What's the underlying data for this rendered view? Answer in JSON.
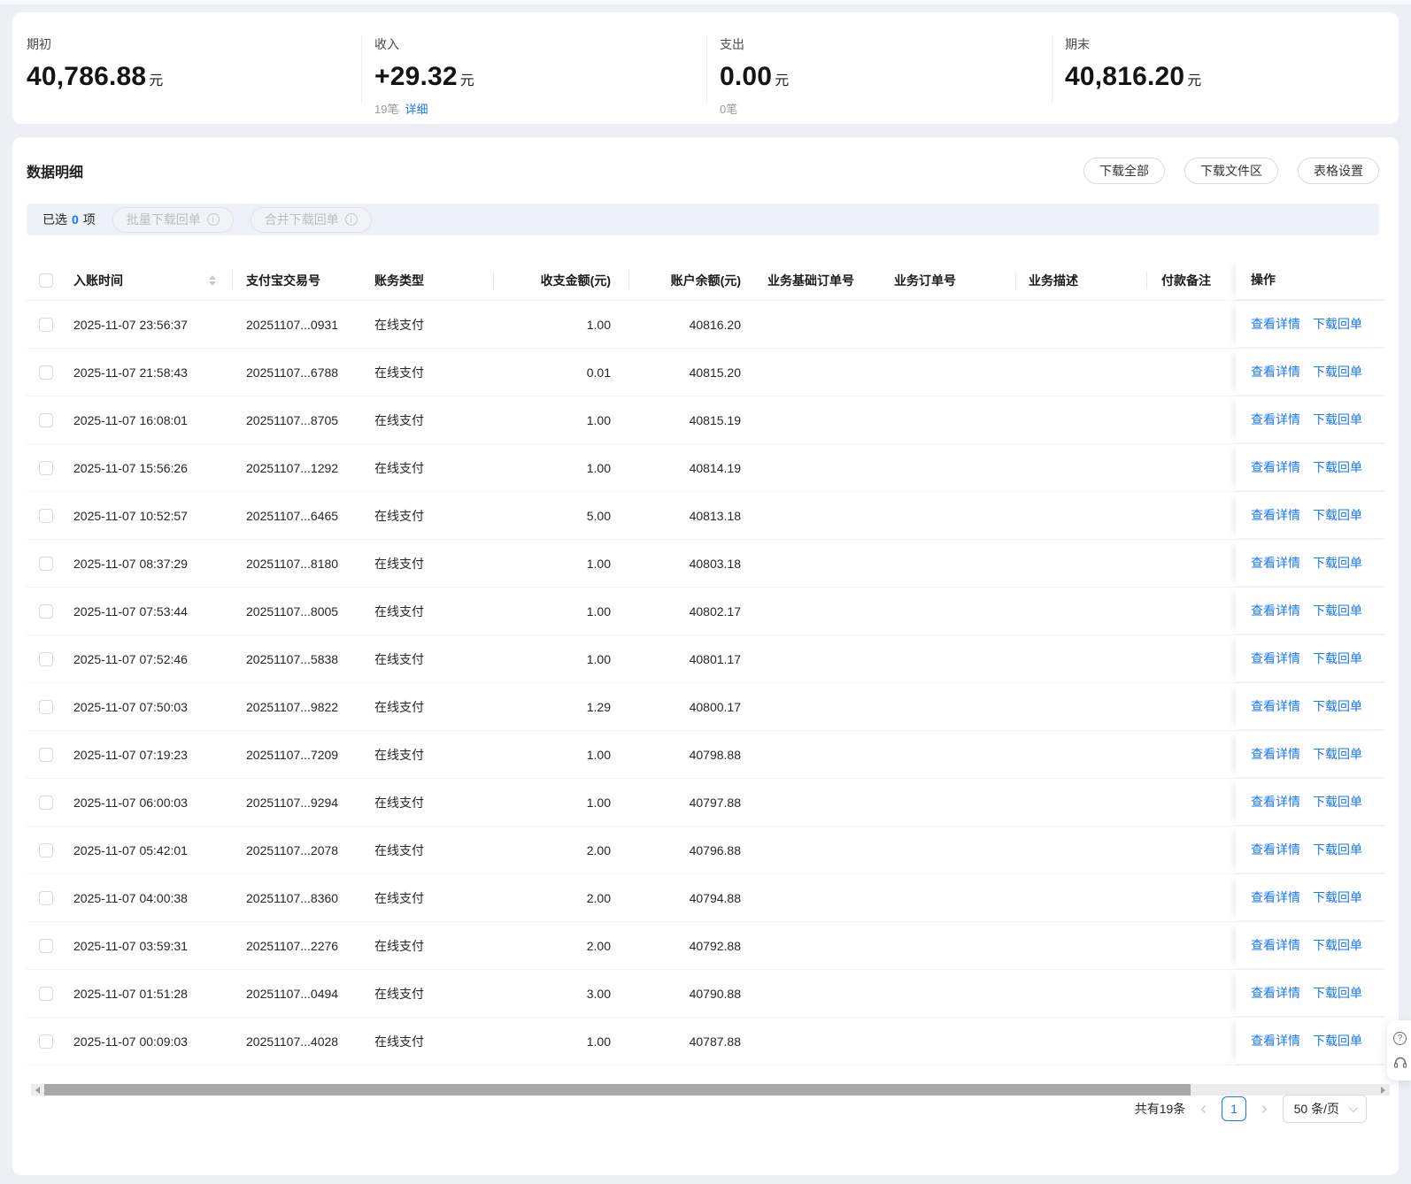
{
  "summary": {
    "items": [
      {
        "label": "期初",
        "value": "40,786.88",
        "unit": "元"
      },
      {
        "label": "收入",
        "value": "+29.32",
        "unit": "元",
        "count": "19笔",
        "detail": "详细"
      },
      {
        "label": "支出",
        "value": "0.00",
        "unit": "元",
        "count": "0笔"
      },
      {
        "label": "期末",
        "value": "40,816.20",
        "unit": "元"
      }
    ]
  },
  "panel": {
    "title": "数据明细",
    "download_all": "下载全部",
    "download_zone": "下载文件区",
    "table_settings": "表格设置",
    "selection": {
      "prefix": "已选",
      "count": "0",
      "suffix": "项",
      "batch_download": "批量下载回单",
      "merge_download": "合并下载回单"
    }
  },
  "table": {
    "columns": [
      "入账时间",
      "支付宝交易号",
      "账务类型",
      "收支金额(元)",
      "账户余额(元)",
      "业务基础订单号",
      "业务订单号",
      "业务描述",
      "付款备注",
      "操作"
    ],
    "actions": {
      "view": "查看详情",
      "receipt": "下载回单"
    },
    "rows": [
      {
        "time": "2025-11-07 23:56:37",
        "txn": "20251107...0931",
        "type": "在线支付",
        "amount": "1.00",
        "balance": "40816.20"
      },
      {
        "time": "2025-11-07 21:58:43",
        "txn": "20251107...6788",
        "type": "在线支付",
        "amount": "0.01",
        "balance": "40815.20"
      },
      {
        "time": "2025-11-07 16:08:01",
        "txn": "20251107...8705",
        "type": "在线支付",
        "amount": "1.00",
        "balance": "40815.19"
      },
      {
        "time": "2025-11-07 15:56:26",
        "txn": "20251107...1292",
        "type": "在线支付",
        "amount": "1.00",
        "balance": "40814.19"
      },
      {
        "time": "2025-11-07 10:52:57",
        "txn": "20251107...6465",
        "type": "在线支付",
        "amount": "5.00",
        "balance": "40813.18"
      },
      {
        "time": "2025-11-07 08:37:29",
        "txn": "20251107...8180",
        "type": "在线支付",
        "amount": "1.00",
        "balance": "40803.18"
      },
      {
        "time": "2025-11-07 07:53:44",
        "txn": "20251107...8005",
        "type": "在线支付",
        "amount": "1.00",
        "balance": "40802.17"
      },
      {
        "time": "2025-11-07 07:52:46",
        "txn": "20251107...5838",
        "type": "在线支付",
        "amount": "1.00",
        "balance": "40801.17"
      },
      {
        "time": "2025-11-07 07:50:03",
        "txn": "20251107...9822",
        "type": "在线支付",
        "amount": "1.29",
        "balance": "40800.17"
      },
      {
        "time": "2025-11-07 07:19:23",
        "txn": "20251107...7209",
        "type": "在线支付",
        "amount": "1.00",
        "balance": "40798.88"
      },
      {
        "time": "2025-11-07 06:00:03",
        "txn": "20251107...9294",
        "type": "在线支付",
        "amount": "1.00",
        "balance": "40797.88"
      },
      {
        "time": "2025-11-07 05:42:01",
        "txn": "20251107...2078",
        "type": "在线支付",
        "amount": "2.00",
        "balance": "40796.88"
      },
      {
        "time": "2025-11-07 04:00:38",
        "txn": "20251107...8360",
        "type": "在线支付",
        "amount": "2.00",
        "balance": "40794.88"
      },
      {
        "time": "2025-11-07 03:59:31",
        "txn": "20251107...2276",
        "type": "在线支付",
        "amount": "2.00",
        "balance": "40792.88"
      },
      {
        "time": "2025-11-07 01:51:28",
        "txn": "20251107...0494",
        "type": "在线支付",
        "amount": "3.00",
        "balance": "40790.88"
      },
      {
        "time": "2025-11-07 00:09:03",
        "txn": "20251107...4028",
        "type": "在线支付",
        "amount": "1.00",
        "balance": "40787.88"
      }
    ]
  },
  "pagination": {
    "total": "共有19条",
    "page": "1",
    "size": "50 条/页"
  },
  "icons": [
    "sort-icon",
    "info-icon",
    "chevron-left-icon",
    "chevron-right-icon",
    "chevron-down-icon",
    "question-icon",
    "headset-icon",
    "scroll-left-icon",
    "scroll-right-icon"
  ],
  "colors": {
    "primary": "#1677ff",
    "background": "#edeff5",
    "selection_bar": "#eef1f7"
  }
}
